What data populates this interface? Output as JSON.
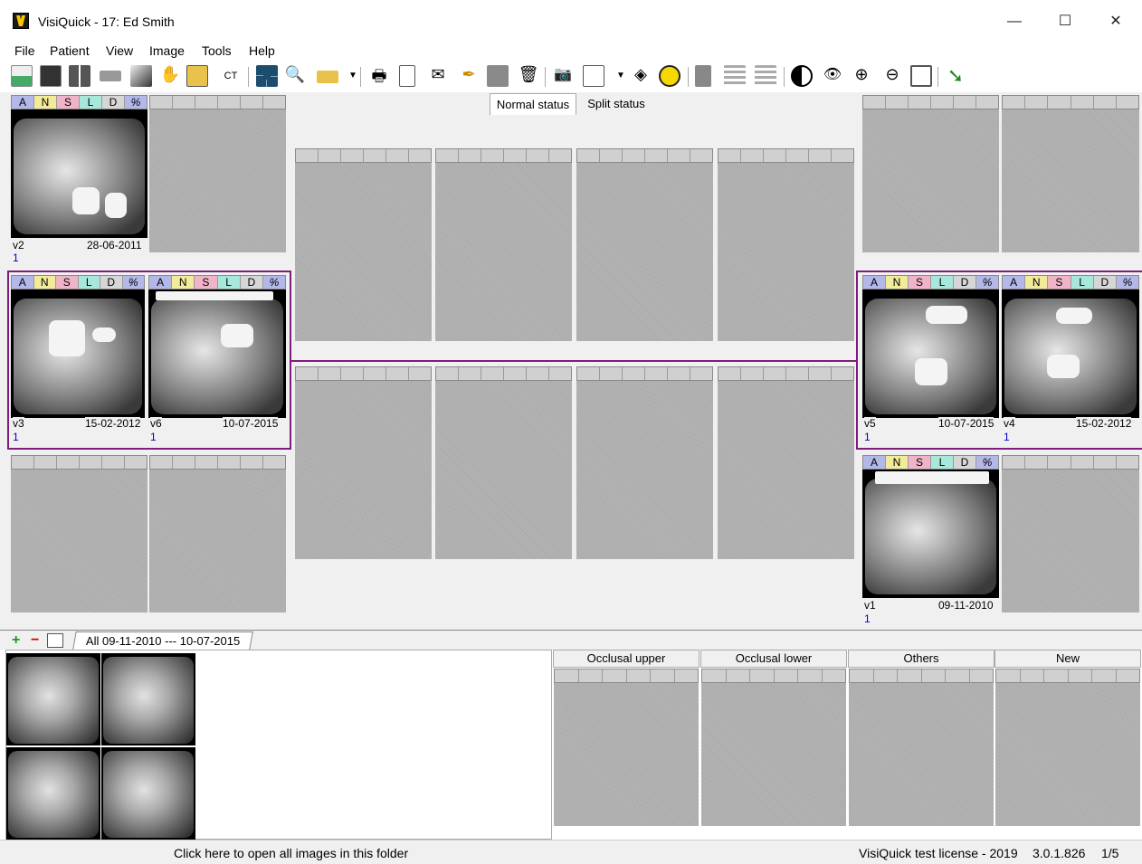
{
  "window": {
    "title": "VisiQuick - 17: Ed Smith",
    "minimize": "—",
    "maximize": "☐",
    "close": "✕"
  },
  "menu": [
    "File",
    "Patient",
    "View",
    "Image",
    "Tools",
    "Help"
  ],
  "toolbar": {
    "ct_label": "CT",
    "icons": [
      "patient-card-icon",
      "patient-list-icon",
      "mirror-icon",
      "scanner-icon",
      "sensor-icon",
      "hand-icon",
      "clipboard-icon",
      "ct-icon",
      "layout-grid-icon",
      "search-icon",
      "link-icon",
      "dropdown-icon",
      "print-icon",
      "page-icon",
      "email-icon",
      "pen-icon",
      "gray-box-icon",
      "delete-icon",
      "camera-icon",
      "import-icon",
      "dropdown-icon",
      "diamond-icon",
      "radiation-icon",
      "export-icon",
      "list-left-icon",
      "list-right-icon",
      "contrast-icon",
      "eye-icon",
      "zoom-in-icon",
      "zoom-out-icon",
      "fit-icon",
      "arrow-down-right-icon"
    ]
  },
  "slot_header_labels": [
    "A",
    "N",
    "S",
    "L",
    "D",
    "%"
  ],
  "status_tabs": {
    "normal": "Normal status",
    "split": "Split status"
  },
  "slots": [
    {
      "version": "v2",
      "date": "28-06-2011",
      "count": "1"
    },
    {
      "version": "v3",
      "date": "15-02-2012",
      "count": "1"
    },
    {
      "version": "v6",
      "date": "10-07-2015",
      "count": "1"
    },
    {
      "version": "v5",
      "date": "10-07-2015",
      "count": "1"
    },
    {
      "version": "v4",
      "date": "15-02-2012",
      "count": "1"
    },
    {
      "version": "v1",
      "date": "09-11-2010",
      "count": "1"
    }
  ],
  "bottom": {
    "add": "+",
    "remove": "−",
    "folder_tab": "All 09-11-2010  ---  10-07-2015"
  },
  "groups": [
    "Occlusal upper",
    "Occlusal lower",
    "Others",
    "New"
  ],
  "statusbar": {
    "hint": "Click here to open all images in this folder",
    "license": "VisiQuick test license - 2019",
    "version": "3.0.1.826",
    "page": "1/5"
  }
}
